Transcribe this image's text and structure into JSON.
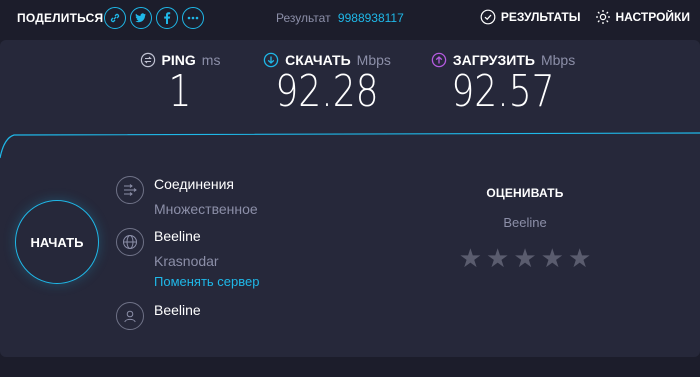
{
  "topbar": {
    "share_label": "ПОДЕЛИТЬСЯ",
    "share_icons": [
      "link-icon",
      "twitter-icon",
      "facebook-icon",
      "more-icon"
    ],
    "result_label": "Результат",
    "result_id": "9988938117",
    "results_label": "РЕЗУЛЬТАТЫ",
    "settings_label": "НАСТРОЙКИ"
  },
  "metrics": {
    "ping": {
      "label": "PING",
      "unit": "ms",
      "value": "1"
    },
    "download": {
      "label": "СКАЧАТЬ",
      "unit": "Mbps",
      "value": "92.28"
    },
    "upload": {
      "label": "ЗАГРУЗИТЬ",
      "unit": "Mbps",
      "value": "92.57"
    }
  },
  "start_button": "НАЧАТЬ",
  "connection": {
    "title": "Соединения",
    "mode": "Множественное"
  },
  "server": {
    "isp": "Beeline",
    "city": "Krasnodar",
    "change_link": "Поменять сервер"
  },
  "host": {
    "isp": "Beeline"
  },
  "rating": {
    "title": "ОЦЕНИВАТЬ",
    "isp": "Beeline",
    "stars_filled": 0,
    "stars_total": 5
  },
  "colors": {
    "accent": "#1fb8e8",
    "upload_accent": "#b55be0",
    "background": "#1c1d2b",
    "panel": "#26283a"
  }
}
